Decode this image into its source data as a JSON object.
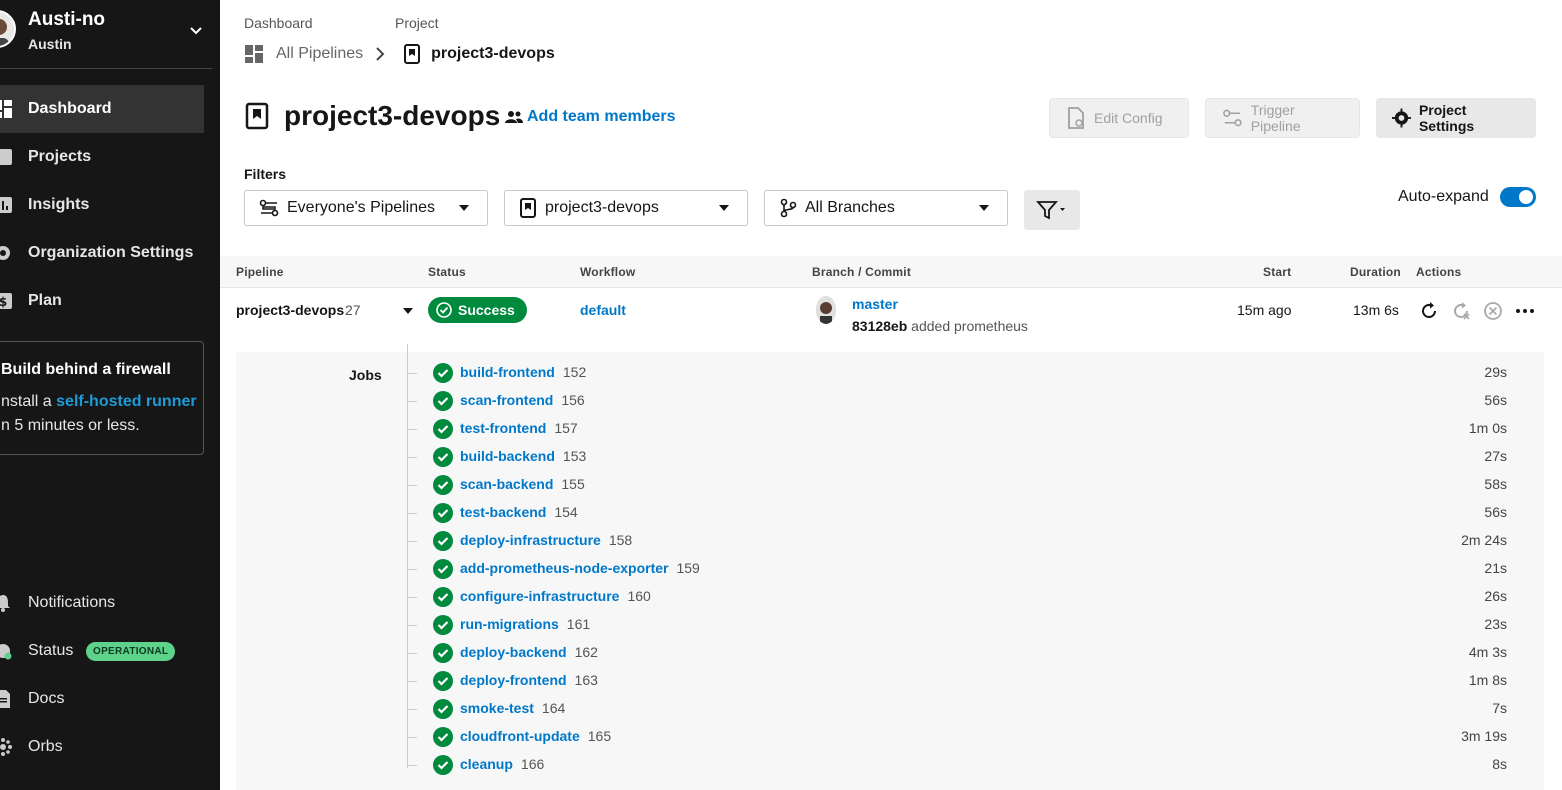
{
  "sidebar": {
    "org_name": "Austi-no",
    "org_user": "Austin",
    "nav": [
      {
        "label": "Dashboard",
        "icon": "dashboard-icon",
        "active": true
      },
      {
        "label": "Projects",
        "icon": "projects-icon"
      },
      {
        "label": "Insights",
        "icon": "insights-icon"
      },
      {
        "label": "Organization Settings",
        "icon": "gear-icon"
      },
      {
        "label": "Plan",
        "icon": "dollar-icon"
      }
    ],
    "firewall": {
      "title": "Build behind a firewall",
      "line1_prefix": "nstall a ",
      "link": "self-hosted runner",
      "line2": "n 5 minutes or less."
    },
    "bottom_nav": [
      {
        "label": "Notifications",
        "icon": "bell-icon"
      },
      {
        "label": "Status",
        "icon": "status-icon",
        "badge": "OPERATIONAL"
      },
      {
        "label": "Docs",
        "icon": "docs-icon"
      },
      {
        "label": "Orbs",
        "icon": "orbs-icon"
      }
    ]
  },
  "breadcrumb": {
    "dashboard_label": "Dashboard",
    "project_label": "Project",
    "all_pipelines": "All Pipelines",
    "project": "project3-devops"
  },
  "header": {
    "title": "project3-devops",
    "add_members": "Add team members",
    "edit_config": "Edit Config",
    "trigger_pipeline": "Trigger Pipeline",
    "project_settings": "Project Settings"
  },
  "filters": {
    "label": "Filters",
    "pipelines": "Everyone's Pipelines",
    "project": "project3-devops",
    "branches": "All Branches",
    "auto_expand_label": "Auto-expand",
    "auto_expand": true
  },
  "table": {
    "headers": {
      "pipeline": "Pipeline",
      "status": "Status",
      "workflow": "Workflow",
      "branch_commit": "Branch / Commit",
      "start": "Start",
      "duration": "Duration",
      "actions": "Actions"
    },
    "pipeline": {
      "name": "project3-devops",
      "number": "27",
      "status": "Success",
      "workflow": "default",
      "branch": "master",
      "commit_hash": "83128eb",
      "commit_message": "added prometheus",
      "start": "15m ago",
      "duration": "13m 6s"
    },
    "jobs_label": "Jobs",
    "jobs": [
      {
        "name": "build-frontend",
        "number": "152",
        "duration": "29s"
      },
      {
        "name": "scan-frontend",
        "number": "156",
        "duration": "56s"
      },
      {
        "name": "test-frontend",
        "number": "157",
        "duration": "1m 0s"
      },
      {
        "name": "build-backend",
        "number": "153",
        "duration": "27s"
      },
      {
        "name": "scan-backend",
        "number": "155",
        "duration": "58s"
      },
      {
        "name": "test-backend",
        "number": "154",
        "duration": "56s"
      },
      {
        "name": "deploy-infrastructure",
        "number": "158",
        "duration": "2m 24s"
      },
      {
        "name": "add-prometheus-node-exporter",
        "number": "159",
        "duration": "21s"
      },
      {
        "name": "configure-infrastructure",
        "number": "160",
        "duration": "26s"
      },
      {
        "name": "run-migrations",
        "number": "161",
        "duration": "23s"
      },
      {
        "name": "deploy-backend",
        "number": "162",
        "duration": "4m 3s"
      },
      {
        "name": "deploy-frontend",
        "number": "163",
        "duration": "1m 8s"
      },
      {
        "name": "smoke-test",
        "number": "164",
        "duration": "7s"
      },
      {
        "name": "cloudfront-update",
        "number": "165",
        "duration": "3m 19s"
      },
      {
        "name": "cleanup",
        "number": "166",
        "duration": "8s"
      }
    ]
  },
  "colors": {
    "sidebar_bg": "#161616",
    "link_blue": "#0078ca",
    "success_green": "#008a3e",
    "badge_green": "#5ed28a"
  }
}
